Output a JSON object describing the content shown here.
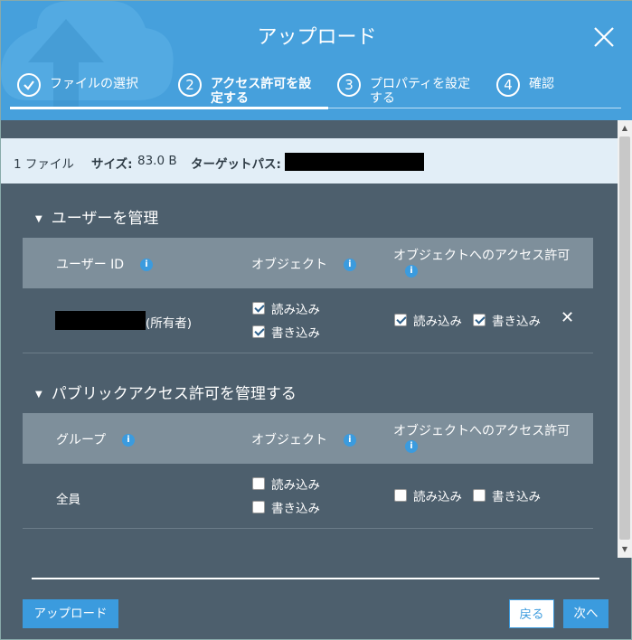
{
  "dialog": {
    "title": "アップロード",
    "steps": [
      {
        "number": "",
        "label": "ファイルの選択",
        "state": "done"
      },
      {
        "number": "2",
        "label": "アクセス許可を設\n定する",
        "state": "active"
      },
      {
        "number": "3",
        "label": "プロパティを設定\nする",
        "state": "pending"
      },
      {
        "number": "4",
        "label": "確認",
        "state": "pending"
      }
    ]
  },
  "infobar": {
    "file_count": "1 ファイル",
    "size_label": "サイズ:",
    "size_value": "83.0 B",
    "target_label": "ターゲットパス:"
  },
  "users_section": {
    "title": "ユーザーを管理",
    "headers": {
      "user_id": "ユーザー ID",
      "object": "オブジェクト",
      "object_acl": "オブジェクトへのアクセス許可"
    },
    "rows": [
      {
        "owner_suffix": "(所有者)",
        "object_read": {
          "label": "読み込み",
          "checked": true
        },
        "object_write": {
          "label": "書き込み",
          "checked": true
        },
        "acl_read": {
          "label": "読み込み",
          "checked": true
        },
        "acl_write": {
          "label": "書き込み",
          "checked": true
        }
      }
    ]
  },
  "public_section": {
    "title": "パブリックアクセス許可を管理する",
    "headers": {
      "group": "グループ",
      "object": "オブジェクト",
      "object_acl": "オブジェクトへのアクセス許可"
    },
    "rows": [
      {
        "group": "全員",
        "object_read": {
          "label": "読み込み",
          "checked": false
        },
        "object_write": {
          "label": "書き込み",
          "checked": false
        },
        "acl_read": {
          "label": "読み込み",
          "checked": false
        },
        "acl_write": {
          "label": "書き込み",
          "checked": false
        }
      }
    ]
  },
  "footer": {
    "upload_button": "アップロード",
    "back_button": "戻る",
    "next_button": "次へ"
  },
  "colors": {
    "header_bg": "#46a0dc",
    "body_bg": "#4d5f6d",
    "accent": "#3b9bde",
    "infobar_bg": "#e2eef7"
  }
}
